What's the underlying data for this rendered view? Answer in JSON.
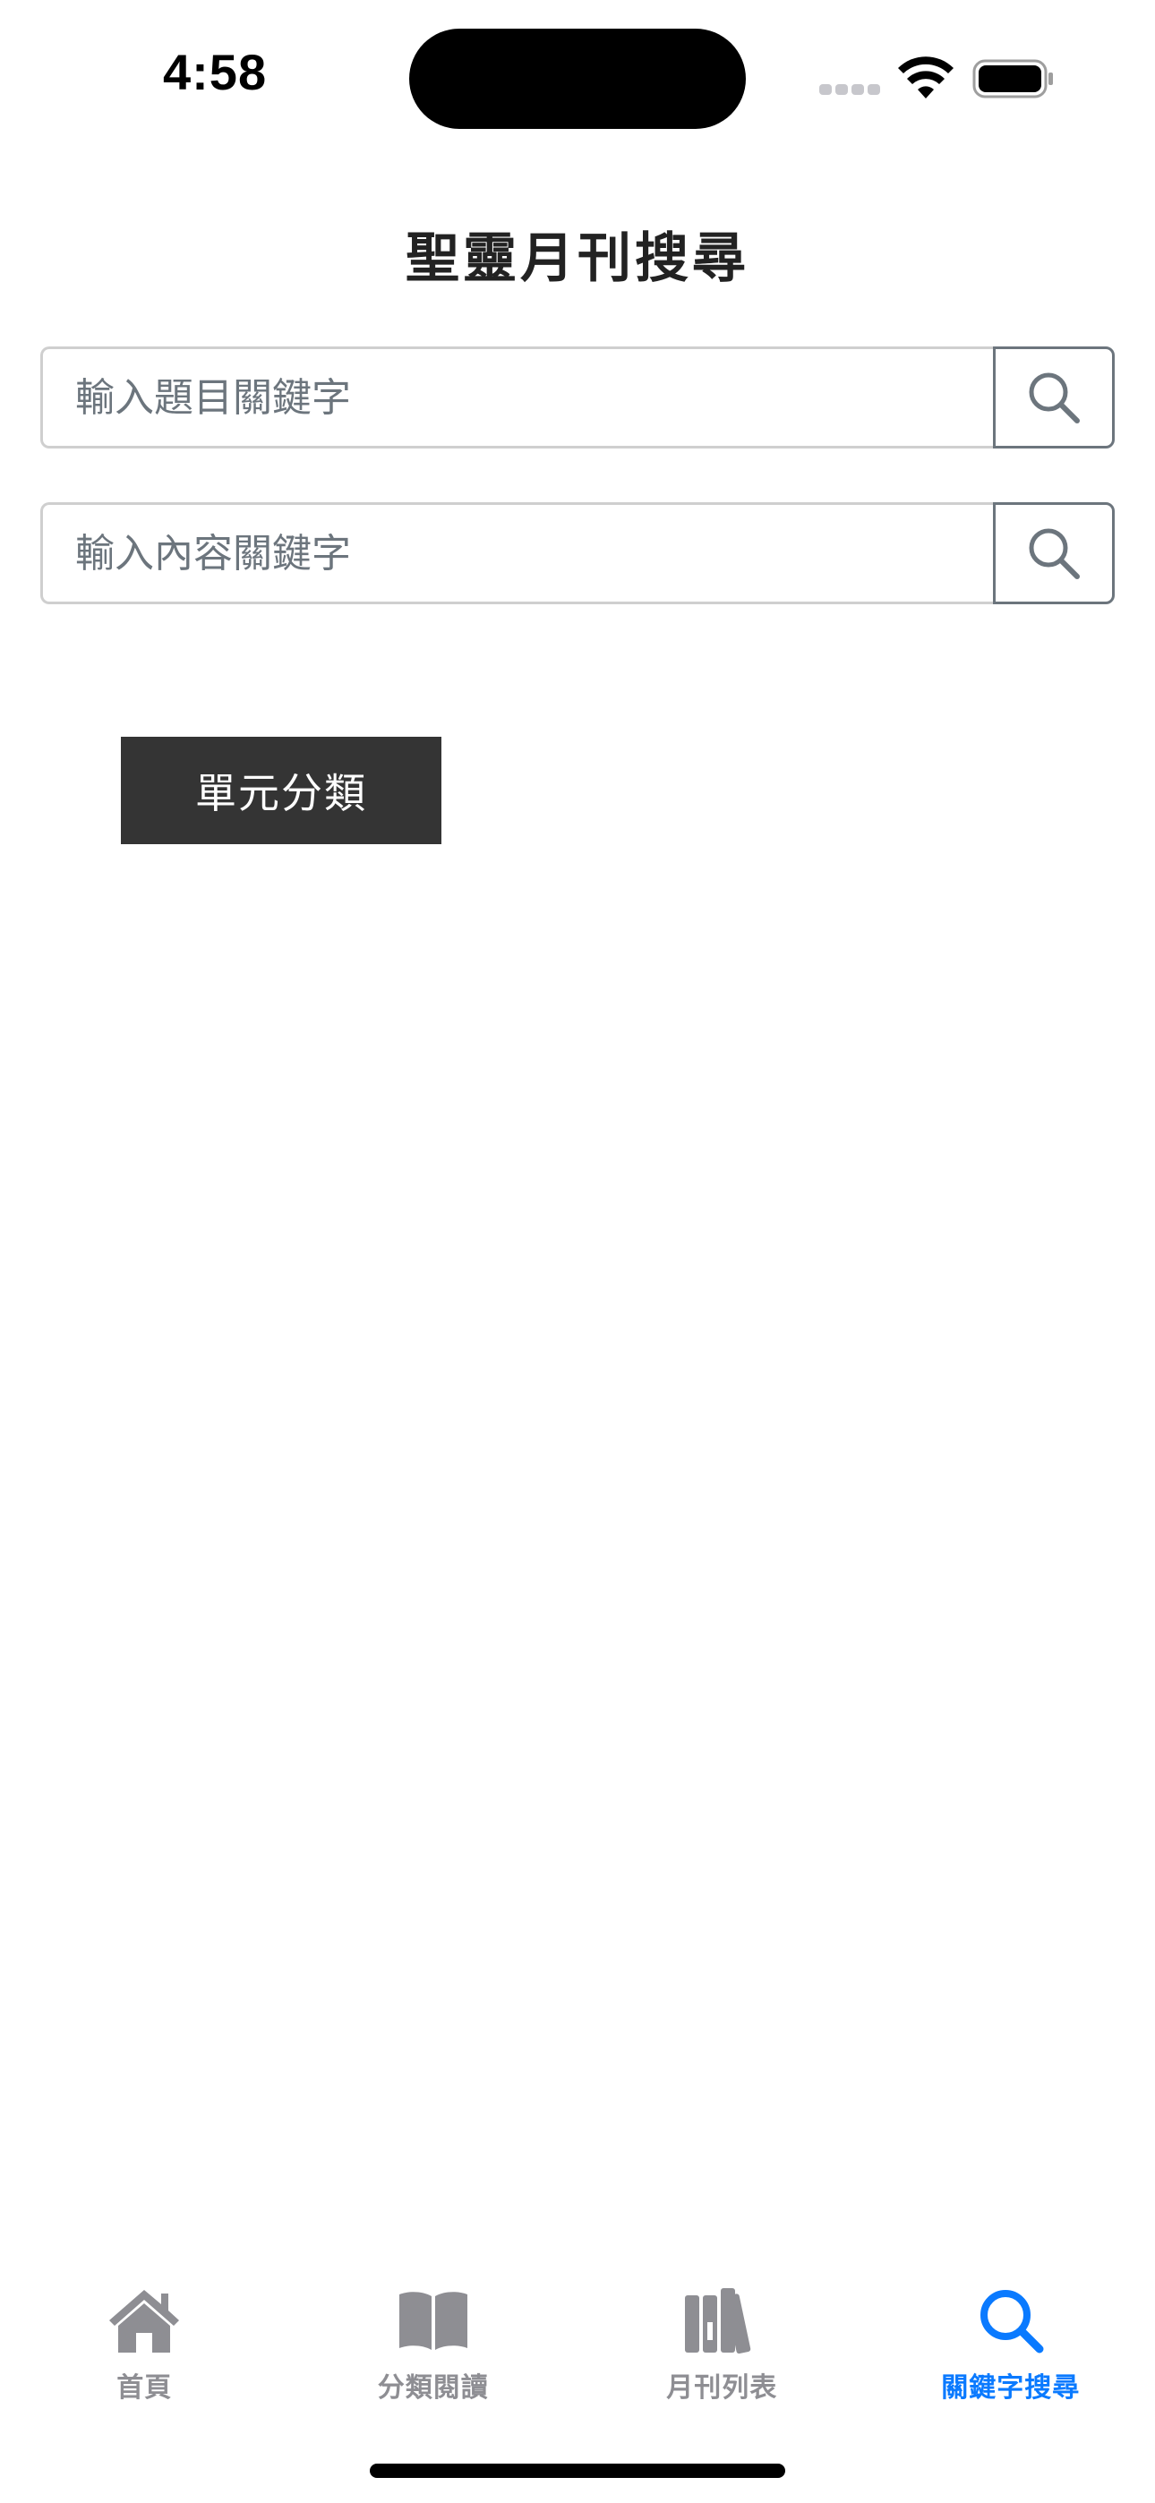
{
  "status_bar": {
    "time": "4:58"
  },
  "header": {
    "title": "聖靈月刊搜尋"
  },
  "search": {
    "title_placeholder": "輸入題目關鍵字",
    "title_value": "",
    "content_placeholder": "輸入內容關鍵字",
    "content_value": "",
    "button_icon": "search-icon"
  },
  "category_button": {
    "label": "單元分類"
  },
  "tab_bar": {
    "active_color": "#0a7aff",
    "inactive_color": "#8e8e93",
    "items": [
      {
        "label": "首頁",
        "icon": "home-icon"
      },
      {
        "label": "分類閱讀",
        "icon": "open-book-icon"
      },
      {
        "label": "月刊列表",
        "icon": "books-icon"
      },
      {
        "label": "關鍵字搜尋",
        "icon": "search-icon",
        "active": true
      }
    ]
  }
}
